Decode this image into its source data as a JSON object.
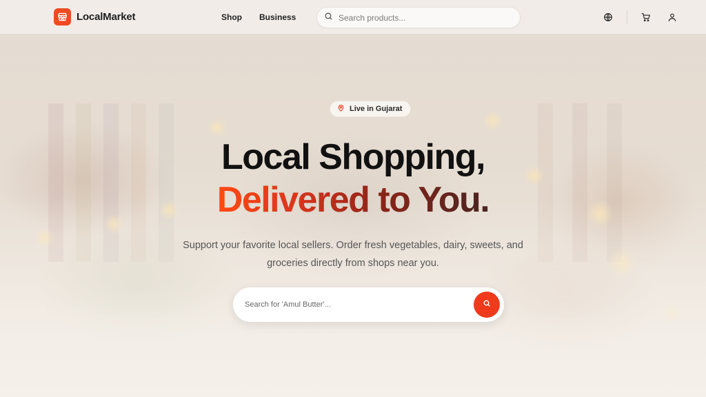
{
  "brand": {
    "name": "LocalMarket",
    "icon": "storefront-icon",
    "color": "#f04a23"
  },
  "nav": {
    "links": [
      "Shop",
      "Business"
    ],
    "search_placeholder": "Search products...",
    "icons": [
      "globe-icon",
      "cart-icon",
      "user-icon"
    ]
  },
  "hero": {
    "badge": {
      "icon": "location-pin-icon",
      "text": "Live in Gujarat"
    },
    "headline_line1": "Local Shopping,",
    "headline_line2": "Delivered to You.",
    "subtitle": "Support your favorite local sellers. Order fresh vegetables, dairy, sweets, and groceries directly from shops near you.",
    "search_placeholder": "Search for 'Amul Butter'...",
    "search_button_icon": "search-icon"
  },
  "colors": {
    "accent": "#f03a1c",
    "text": "#111111",
    "muted": "#555555"
  }
}
